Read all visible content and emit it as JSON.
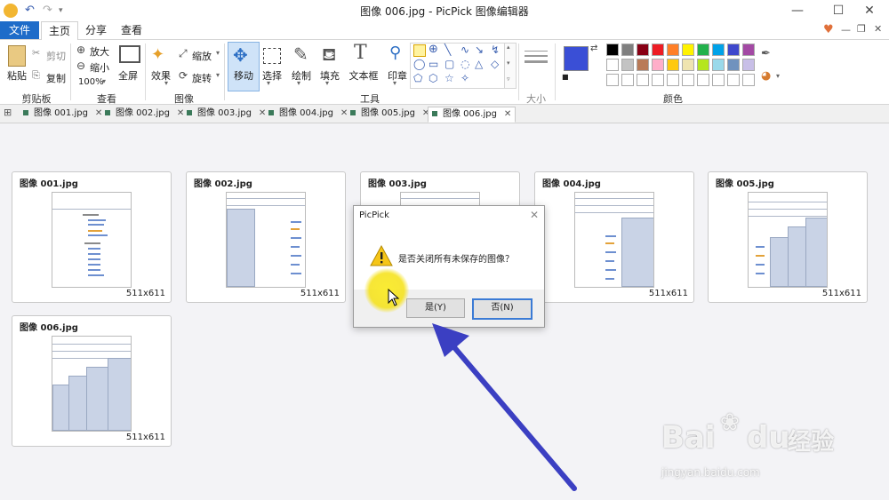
{
  "window": {
    "title": "图像 006.jpg - PicPick 图像编辑器"
  },
  "menu": {
    "file": "文件",
    "home": "主页",
    "share": "分享",
    "view": "查看"
  },
  "ribbon": {
    "paste": "粘贴",
    "cut": "剪切",
    "copy": "复制",
    "clipboard": "剪贴板",
    "zoom_in": "放大",
    "zoom_out": "缩小",
    "zoom_level": "100%",
    "fullscreen": "全屏",
    "view_group": "查看",
    "effects": "效果",
    "resize": "缩放",
    "rotate": "旋转",
    "image_group": "图像",
    "move": "移动",
    "select": "选择",
    "draw": "绘制",
    "fill": "填充",
    "textbox": "文本框",
    "stamp": "印章",
    "tools_group": "工具",
    "size_group": "大小",
    "colors_group": "颜色"
  },
  "colors": {
    "primary": "#3a4fd6",
    "secondary": "#ffffff",
    "palette_row1": [
      "#000000",
      "#7f7f7f",
      "#880015",
      "#ed1c24",
      "#ff7f27",
      "#fff200",
      "#22b14c",
      "#00a2e8",
      "#3f48cc",
      "#a349a4"
    ],
    "palette_row2": [
      "#ffffff",
      "#c3c3c3",
      "#b97a57",
      "#ffaec9",
      "#ffc90e",
      "#efe4b0",
      "#b5e61d",
      "#99d9ea",
      "#7092be",
      "#c8bfe7"
    ],
    "palette_row3": [
      "#ffffff",
      "#ffffff",
      "#ffffff",
      "#ffffff",
      "#ffffff",
      "#ffffff",
      "#ffffff",
      "#ffffff",
      "#ffffff",
      "#ffffff"
    ]
  },
  "tabs": [
    {
      "label": "图像 001.jpg"
    },
    {
      "label": "图像 002.jpg"
    },
    {
      "label": "图像 003.jpg"
    },
    {
      "label": "图像 004.jpg"
    },
    {
      "label": "图像 005.jpg"
    },
    {
      "label": "图像 006.jpg"
    }
  ],
  "thumbnails": [
    {
      "name": "图像 001.jpg",
      "size": "511x611"
    },
    {
      "name": "图像 002.jpg",
      "size": "511x611"
    },
    {
      "name": "图像 003.jpg",
      "size": "511x611"
    },
    {
      "name": "图像 004.jpg",
      "size": "511x611"
    },
    {
      "name": "图像 005.jpg",
      "size": "511x611"
    },
    {
      "name": "图像 006.jpg",
      "size": "511x611"
    }
  ],
  "dialog": {
    "title": "PicPick",
    "message": "是否关闭所有未保存的图像？",
    "yes": "是(Y)",
    "no": "否(N)"
  },
  "watermark": {
    "brand": "Bai",
    "brand2": "du",
    "cn": "经验",
    "url": "jingyan.baidu.com"
  }
}
